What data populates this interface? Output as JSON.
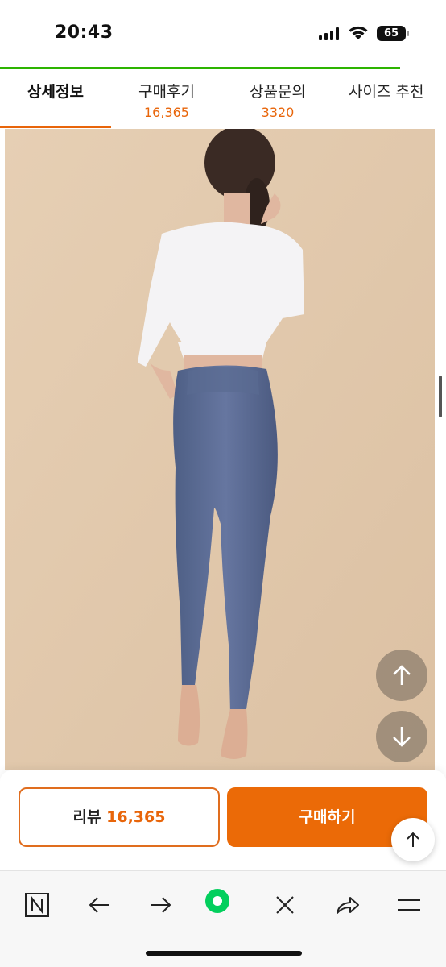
{
  "status_bar": {
    "time": "20:43",
    "battery": "65"
  },
  "tabs": [
    {
      "label": "상세정보",
      "count": ""
    },
    {
      "label": "구매후기",
      "count": "16,365"
    },
    {
      "label": "상품문의",
      "count": "3320"
    },
    {
      "label": "사이즈 추천",
      "count": ""
    }
  ],
  "product_image": {
    "description_icon": "leggings-photo"
  },
  "action_bar": {
    "review_label": "리뷰",
    "review_count": "16,365",
    "buy_label": "구매하기"
  },
  "colors": {
    "accent": "#eb6a07",
    "progress": "#2db400",
    "photo_bg": "#e2c9ad"
  }
}
